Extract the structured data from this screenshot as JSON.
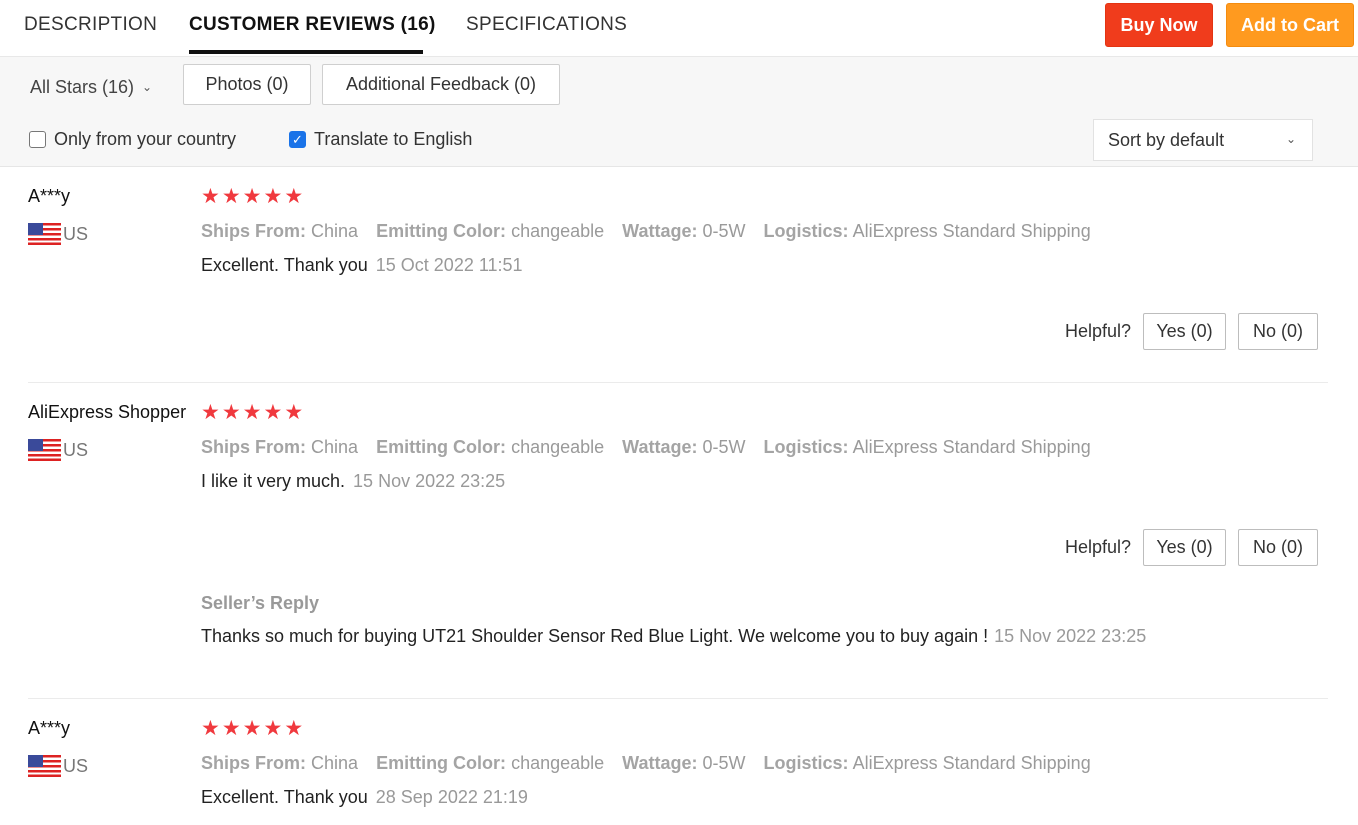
{
  "tabs": [
    {
      "label": "DESCRIPTION"
    },
    {
      "label": "CUSTOMER REVIEWS (16)"
    },
    {
      "label": "SPECIFICATIONS"
    }
  ],
  "actions": {
    "buy_now": "Buy Now",
    "add_to_cart": "Add to Cart"
  },
  "filters": {
    "stars_select": "All Stars (16)",
    "photos": "Photos (0)",
    "additional_feedback": "Additional Feedback (0)",
    "only_country": "Only from your country",
    "only_country_checked": false,
    "translate": "Translate to English",
    "translate_checked": true,
    "sort": "Sort by default"
  },
  "labels": {
    "ships_from": "Ships From:",
    "emitting_color": "Emitting Color:",
    "wattage": "Wattage:",
    "logistics": "Logistics:",
    "helpful": "Helpful?",
    "seller_reply": "Seller’s Reply"
  },
  "reviews": [
    {
      "name": "A***y",
      "country": "US",
      "stars": 5,
      "ships_from": "China",
      "emitting_color": "changeable",
      "wattage": "0-5W",
      "logistics": "AliExpress Standard Shipping",
      "text": "Excellent. Thank you",
      "date": "15 Oct 2022 11:51",
      "yes": "Yes (0)",
      "no": "No (0)"
    },
    {
      "name": "AliExpress Shopper",
      "country": "US",
      "stars": 5,
      "ships_from": "China",
      "emitting_color": "changeable",
      "wattage": "0-5W",
      "logistics": "AliExpress Standard Shipping",
      "text": "I like it very much.",
      "date": "15 Nov 2022 23:25",
      "yes": "Yes (0)",
      "no": "No (0)",
      "reply_text": "Thanks so much for buying UT21 Shoulder Sensor Red Blue Light. We welcome you to buy again !",
      "reply_date": "15 Nov 2022 23:25"
    },
    {
      "name": "A***y",
      "country": "US",
      "stars": 5,
      "ships_from": "China",
      "emitting_color": "changeable",
      "wattage": "0-5W",
      "logistics": "AliExpress Standard Shipping",
      "text": "Excellent. Thank you",
      "date": "28 Sep 2022 21:19"
    }
  ],
  "colors": {
    "star": "#f0393e",
    "buy_now": "#f03c1c",
    "add_to_cart": "#ff9a1f",
    "checkbox": "#1a73e8"
  }
}
